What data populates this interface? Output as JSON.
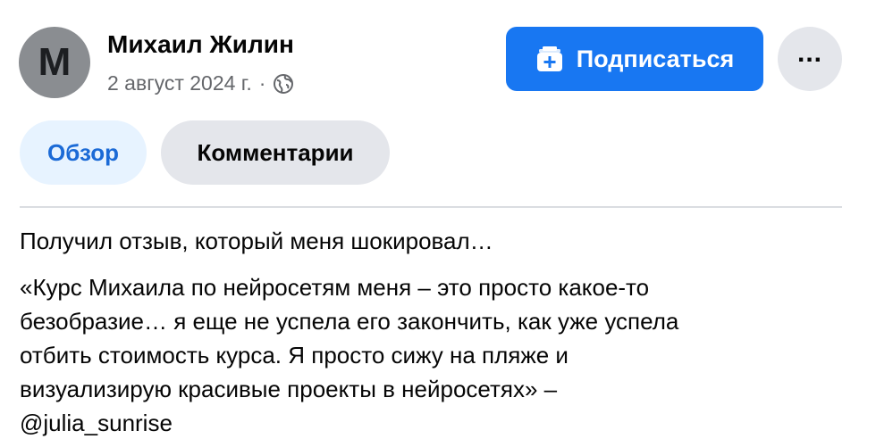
{
  "author": {
    "avatar_letter": "M",
    "name": "Михаил Жилин",
    "date": "2 август 2024 г.",
    "separator": "·",
    "privacy_icon": "globe-icon"
  },
  "actions": {
    "subscribe_label": "Подписаться",
    "subscribe_icon": "subscribe-icon",
    "more_label": "...",
    "accent_color": "#1877f2"
  },
  "tabs": [
    {
      "label": "Обзор",
      "active": true
    },
    {
      "label": "Комментарии",
      "active": false
    }
  ],
  "post": {
    "lead": "Получил отзыв, который меня шокировал…",
    "body_lines": [
      "«Курс Михаила по нейросетям меня – это просто какое-то",
      "безобразие… я еще не успела его закончить, как уже успела",
      "отбить стоимость курса. Я просто сижу на пляже и",
      "визуализирую красивые проекты в нейросетях» –",
      "@julia_sunrise"
    ]
  }
}
